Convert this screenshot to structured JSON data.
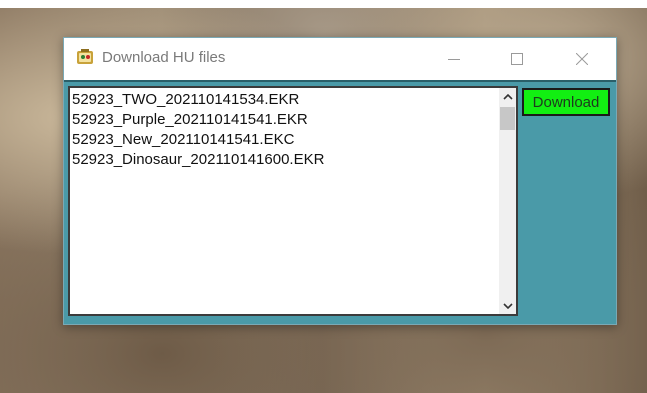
{
  "window": {
    "title": "Download HU files"
  },
  "files": [
    "52923_TWO_202110141534.EKR",
    "52923_Purple_202110141541.EKR",
    "52923_New_202110141541.EKC",
    "52923_Dinosaur_202110141600.EKR"
  ],
  "buttons": {
    "download_label": "Download"
  },
  "colors": {
    "client_background": "#4a9aa8",
    "download_button": "#12ef12"
  }
}
